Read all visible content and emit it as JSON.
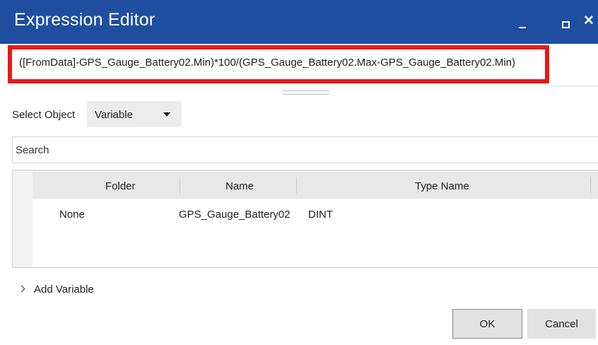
{
  "window": {
    "title": "Expression Editor",
    "controls": [
      "minimize",
      "maximize",
      "close"
    ],
    "close_glyph": "✕"
  },
  "expression": {
    "value": "([FromData]-GPS_Gauge_Battery02.Min)*100/(GPS_Gauge_Battery02.Max-GPS_Gauge_Battery02.Min)",
    "highlight_color": "#e51919"
  },
  "select_object": {
    "label": "Select Object",
    "value": "Variable"
  },
  "search": {
    "placeholder": "Search"
  },
  "grid": {
    "columns": [
      "Folder",
      "Name",
      "Type Name"
    ],
    "rows": [
      {
        "folder": "None",
        "name": "GPS_Gauge_Battery02",
        "type_name": "DINT"
      }
    ]
  },
  "add_variable": {
    "label": "Add Variable"
  },
  "buttons": {
    "ok": "OK",
    "cancel": "Cancel"
  },
  "colors": {
    "title_bar": "#1f4e9e",
    "button_bg": "#e2e2e2"
  }
}
